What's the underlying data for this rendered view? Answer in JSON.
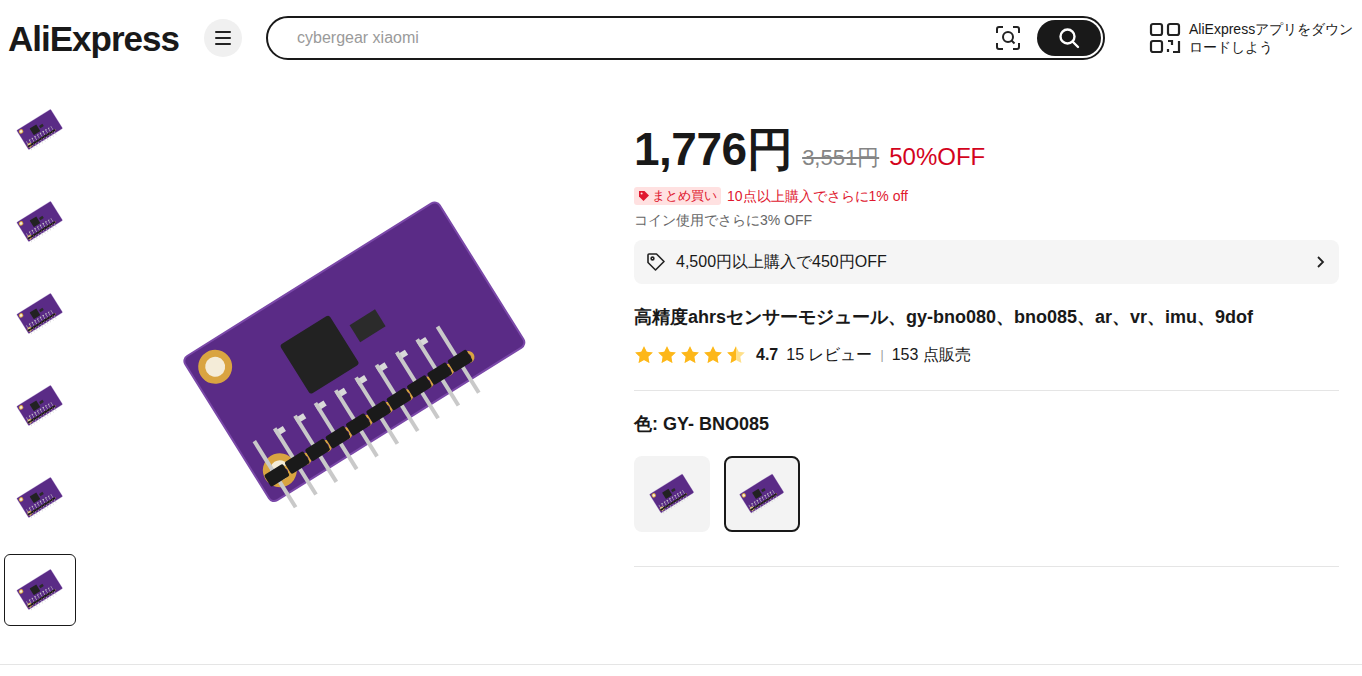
{
  "header": {
    "logo": "AliExpress",
    "search": {
      "placeholder": "cybergear xiaomi"
    },
    "app_promo": [
      "AliExpressアプリをダウン",
      "ロードしよう"
    ]
  },
  "gallery": {
    "thumbnails": [
      {
        "selected": false
      },
      {
        "selected": false
      },
      {
        "selected": false
      },
      {
        "selected": false
      },
      {
        "selected": false
      },
      {
        "selected": true
      }
    ]
  },
  "product": {
    "price": "1,776円",
    "original_price": "3,551円",
    "discount": "50%OFF",
    "bulk_badge": "まとめ買い",
    "bulk_text": "10点以上購入でさらに1% off",
    "coin_text": "コイン使用でさらに3% OFF",
    "coupon": "4,500円以上購入で450円OFF",
    "title": "高精度ahrsセンサーモジュール、gy-bno080、bno085、ar、vr、imu、9dof",
    "rating": {
      "stars": 4.5,
      "score": "4.7",
      "reviews": "15 レビュー",
      "separator": "|",
      "sold": "153 点販売"
    },
    "variant": {
      "label": "色: GY- BNO085",
      "options": [
        {
          "selected": false
        },
        {
          "selected": true
        }
      ]
    }
  }
}
